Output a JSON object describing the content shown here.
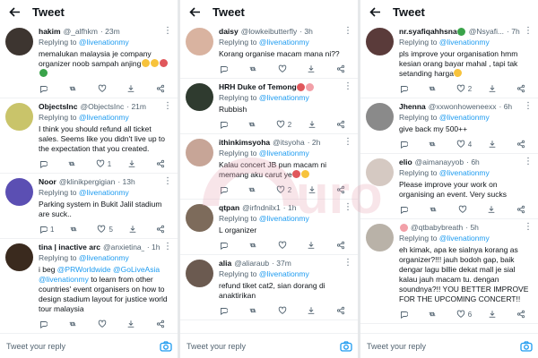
{
  "header_title": "Tweet",
  "compose_placeholder": "Tweet your reply",
  "watermark_text": "oh!media",
  "colors": {
    "accent": "#1d9bf0",
    "muted": "#536471",
    "text": "#0f1419"
  },
  "columns": [
    {
      "tweets": [
        {
          "name": "hakim",
          "handle": "@_alfhkm",
          "time": "· 23m",
          "replying_label": "Replying to ",
          "replying_to": "@livenationmy",
          "text": "memalukan malaysia je company organizer noob sampah anjing",
          "emojis": [
            "e-y",
            "e-y",
            "e-r",
            "e-g"
          ],
          "counts": {
            "reply": "",
            "retweet": "",
            "like": ""
          },
          "avatar": "#3d3530"
        },
        {
          "name": "ObjectsInc",
          "handle": "@ObjectsInc",
          "time": "· 21m",
          "replying_label": "Replying to ",
          "replying_to": "@livenationmy",
          "text": "I think you should refund all ticket sales. Seems like you didn't live up to the expectation that you created.",
          "emojis": [],
          "counts": {
            "reply": "",
            "retweet": "",
            "like": "1"
          },
          "avatar": "#c9c46a"
        },
        {
          "name": "Noor",
          "handle": "@klinikpergigian",
          "time": "· 13h",
          "replying_label": "Replying to ",
          "replying_to": "@livenationmy",
          "text": "Parking system in Bukit Jalil stadium are suck..",
          "emojis": [],
          "counts": {
            "reply": "1",
            "retweet": "",
            "like": "5"
          },
          "avatar": "#5b4fb3"
        },
        {
          "name": "tina | inactive arc",
          "handle": "@anxietina_",
          "time": "· 1h",
          "replying_label": "Replying to ",
          "replying_to": "@livenationmy",
          "text_parts": [
            "i beg ",
            "@PRWorldwide",
            " ",
            "@GoLiveAsia",
            "\n",
            "@livenationmy",
            " to learn from other countries' event organisers on how to design stadium layout for justice world tour malaysia"
          ],
          "mention_idx": [
            1,
            3,
            5
          ],
          "emojis": [],
          "counts": {
            "reply": "",
            "retweet": "",
            "like": ""
          },
          "avatar": "#3a2a1e"
        }
      ]
    },
    {
      "tweets": [
        {
          "name": "daisy",
          "handle": "@lowkeibutterfly",
          "time": "· 3h",
          "replying_label": "Replying to ",
          "replying_to": "@livenationmy",
          "text": "Korang organise macam mana ni??",
          "emojis": [],
          "counts": {
            "reply": "",
            "retweet": "",
            "like": ""
          },
          "avatar": "#d9b3a0"
        },
        {
          "name": "HRH Duke of Temong",
          "handle": "",
          "time": "",
          "replying_label": "Replying to ",
          "replying_to": "@livenationmy",
          "text": "Rubbish",
          "name_emojis": [
            "e-r",
            "e-p"
          ],
          "emojis": [],
          "counts": {
            "reply": "",
            "retweet": "",
            "like": "2"
          },
          "avatar": "#2f3b2f"
        },
        {
          "name": "ithinkimsyoha",
          "handle": "@itsyoha",
          "time": "· 2h",
          "replying_label": "Replying to ",
          "replying_to": "@livenationmy",
          "text": "Kalau concert JB pun macam ni memang aku carut ye",
          "emojis": [
            "e-r",
            "e-y"
          ],
          "counts": {
            "reply": "",
            "retweet": "",
            "like": "2"
          },
          "avatar": "#c7a597"
        },
        {
          "name": "qtpan",
          "handle": "@irfndnilx1",
          "time": "· 1h",
          "replying_label": "Replying to ",
          "replying_to": "@livenationmy",
          "text": "L organizer",
          "emojis": [],
          "counts": {
            "reply": "",
            "retweet": "",
            "like": ""
          },
          "avatar": "#7d6b5b"
        },
        {
          "name": "alia",
          "handle": "@aliaraub",
          "time": "· 37m",
          "replying_label": "Replying to ",
          "replying_to": "@livenationmy",
          "text": "refund tiket cat2, sian dorang di anaktirikan",
          "emojis": [],
          "counts": {
            "reply": "",
            "retweet": "",
            "like": ""
          },
          "avatar": "#6b5a50"
        }
      ]
    },
    {
      "tweets": [
        {
          "name": "nr.syafiqahhsna",
          "handle": "@Nsyafi...",
          "time": "· 7h",
          "replying_label": "Replying to ",
          "replying_to": "@livenationmy",
          "text": "pls improve your organisation hmm kesian orang bayar mahal , tapi tak setanding harga",
          "name_emojis": [
            "e-g"
          ],
          "emojis": [
            "e-y"
          ],
          "counts": {
            "reply": "",
            "retweet": "",
            "like": "2"
          },
          "avatar": "#5a3b3a"
        },
        {
          "name": "Jhenna",
          "handle": "@xxwonhoweneexx",
          "time": "· 6h",
          "replying_label": "Replying to ",
          "replying_to": "@livenationmy",
          "text": "give back my 500++",
          "emojis": [],
          "counts": {
            "reply": "",
            "retweet": "",
            "like": "4"
          },
          "avatar": "#8a8a8a"
        },
        {
          "name": "elio",
          "handle": "@aimanayyob",
          "time": "· 6h",
          "replying_label": "Replying to ",
          "replying_to": "@livenationmy",
          "text": "Please improve your work on organising an event. Very sucks",
          "emojis": [],
          "counts": {
            "reply": "",
            "retweet": "",
            "like": ""
          },
          "avatar": "#d5c9c2"
        },
        {
          "name": "",
          "handle": "@qtbabybreath",
          "time": "· 5h",
          "replying_label": "Replying to ",
          "replying_to": "@livenationmy",
          "text": "eh kimak, apa ke sialnya korang as organizer?!!! jauh bodoh gap, baik dengar lagu billie dekat mall je sial kalau jauh macam tu. dengan soundnya?!! YOU BETTER IMPROVE FOR THE UPCOMING CONCERT!!",
          "name_emojis": [
            "e-p"
          ],
          "emojis": [],
          "counts": {
            "reply": "",
            "retweet": "",
            "like": "6"
          },
          "avatar": "#b9b2a8"
        }
      ]
    }
  ]
}
